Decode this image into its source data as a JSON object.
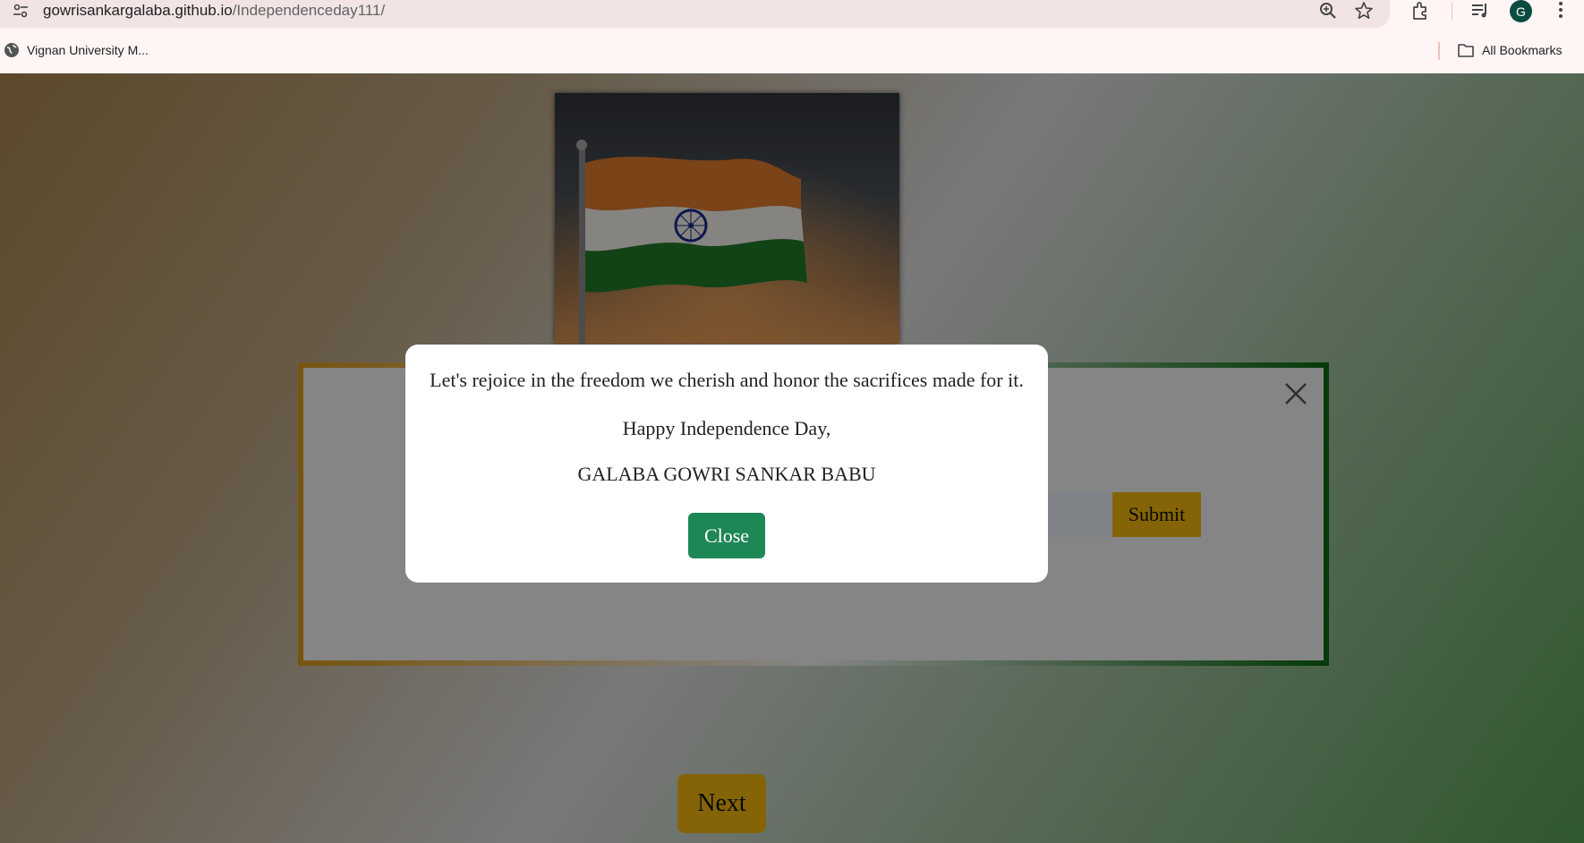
{
  "browser": {
    "url_host": "gowrisankargalaba.github.io",
    "url_path": "/Independenceday111/",
    "profile_initial": "G",
    "bookmarks": [
      {
        "label": "Vignan University M..."
      }
    ],
    "all_bookmarks_label": "All Bookmarks"
  },
  "page": {
    "submit_label": "Submit",
    "next_label": "Next"
  },
  "modal": {
    "message": "Let's rejoice in the freedom we cherish and honor the sacrifices made for it.",
    "greeting": "Happy Independence Day,",
    "name": "GALABA GOWRI SANKAR BABU",
    "close_label": "Close"
  },
  "colors": {
    "saffron": "#f0b70c",
    "close_green": "#1e8756",
    "border_green": "#0b6b12"
  }
}
